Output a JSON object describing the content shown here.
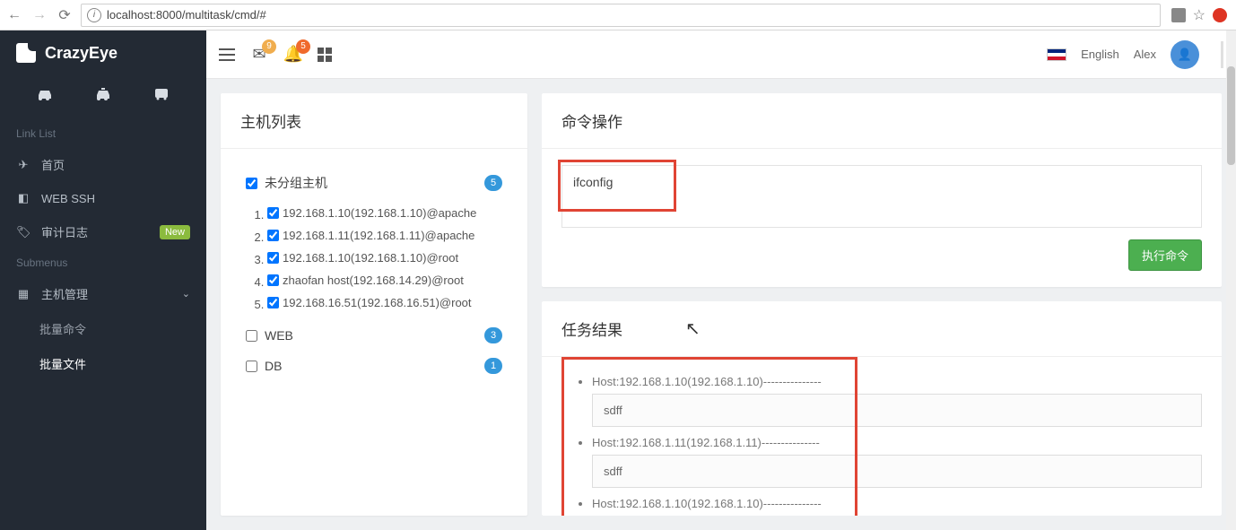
{
  "browser": {
    "url": "localhost:8000/multitask/cmd/#"
  },
  "brand": "CrazyEye",
  "sections": {
    "linklist": "Link List",
    "submenus": "Submenus"
  },
  "nav": {
    "home": "首页",
    "webssh": "WEB SSH",
    "audit": "审计日志",
    "new_badge": "New",
    "hostmgmt": "主机管理",
    "batchcmd": "批量命令",
    "batchfile": "批量文件"
  },
  "topbar": {
    "env_badge": "9",
    "bell_badge": "5",
    "lang": "English",
    "user": "Alex"
  },
  "hostpanel": {
    "title": "主机列表",
    "groups": [
      {
        "label": "未分组主机",
        "checked": true,
        "count": "5",
        "hosts": [
          "192.168.1.10(192.168.1.10)@apache",
          "192.168.1.11(192.168.1.11)@apache",
          "192.168.1.10(192.168.1.10)@root",
          "zhaofan host(192.168.14.29)@root",
          "192.168.16.51(192.168.16.51)@root"
        ]
      },
      {
        "label": "WEB",
        "checked": false,
        "count": "3"
      },
      {
        "label": "DB",
        "checked": false,
        "count": "1"
      }
    ]
  },
  "cmdpanel": {
    "title": "命令操作",
    "value": "ifconfig",
    "run_label": "执行命令"
  },
  "resultpanel": {
    "title": "任务结果",
    "items": [
      {
        "host": "Host:192.168.1.10(192.168.1.10)---------------",
        "output": "sdff"
      },
      {
        "host": "Host:192.168.1.11(192.168.1.11)---------------",
        "output": "sdff"
      },
      {
        "host": "Host:192.168.1.10(192.168.1.10)---------------",
        "output": ""
      }
    ]
  }
}
